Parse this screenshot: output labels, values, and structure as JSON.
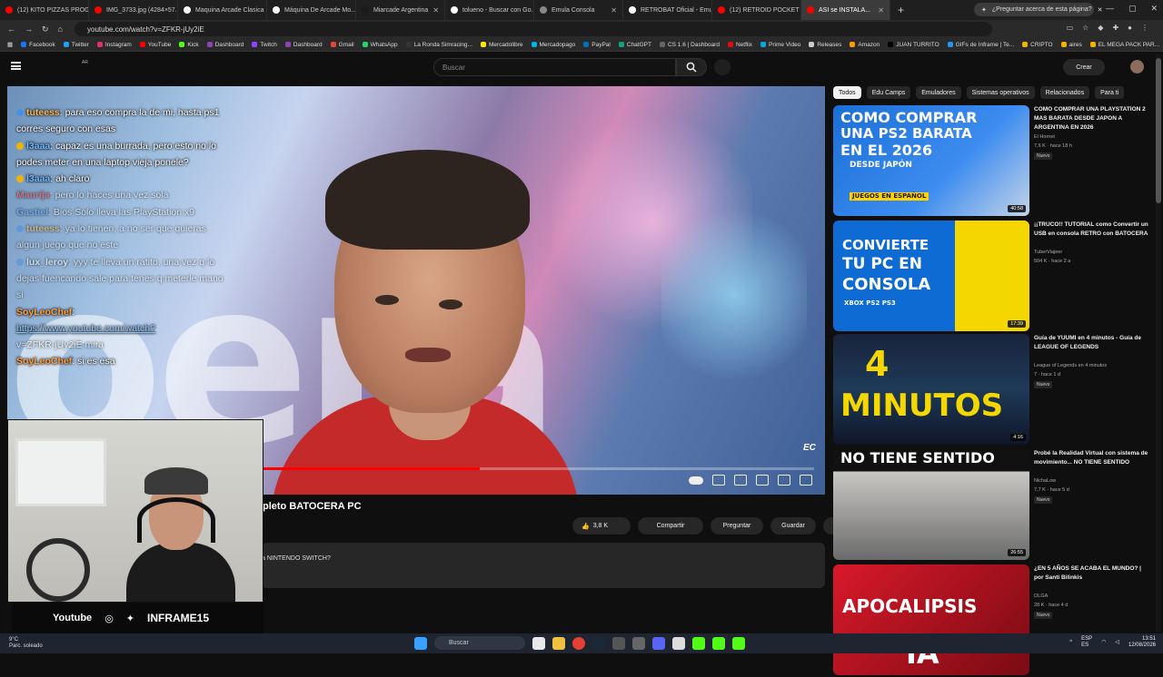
{
  "browser": {
    "tabs": [
      {
        "label": "(12) KITO PIZZAS PROGI...",
        "color": "#ff0000"
      },
      {
        "label": "IMG_3733.jpg (4284×57...",
        "color": "#ff0000"
      },
      {
        "label": "Maquina Arcade Clasica",
        "color": "#ffffff"
      },
      {
        "label": "Máquina De Arcade Mo...",
        "color": "#ffffff"
      },
      {
        "label": "Miarcade Argentina",
        "color": "#1a1a1a"
      },
      {
        "label": "tolueno - Buscar con Go...",
        "color": "#ffffff"
      },
      {
        "label": "Emula Consola",
        "color": "#888888"
      },
      {
        "label": "RETROBAT Oficial - Emu...",
        "color": "#ffffff"
      },
      {
        "label": "(12) RETROID POCKET 6...",
        "color": "#ff0000"
      },
      {
        "label": "ASI se INSTALA...",
        "color": "#ff0000",
        "active": true
      }
    ],
    "ask_tab": "¿Preguntar acerca de esta página?",
    "address": "youtube.com/watch?v=ZFKR-jUy2iE",
    "bookmarks": [
      {
        "label": "Facebook",
        "color": "#1877f2"
      },
      {
        "label": "Twitter",
        "color": "#1da1f2"
      },
      {
        "label": "Instagram",
        "color": "#e1306c"
      },
      {
        "label": "YouTube",
        "color": "#ff0000"
      },
      {
        "label": "Kick",
        "color": "#53fc18"
      },
      {
        "label": "Dashboard",
        "color": "#8e44ad"
      },
      {
        "label": "Twitch",
        "color": "#9146ff"
      },
      {
        "label": "Dashboard",
        "color": "#8e44ad"
      },
      {
        "label": "Gmail",
        "color": "#ea4335"
      },
      {
        "label": "WhatsApp",
        "color": "#25d366"
      },
      {
        "label": "La Ronda Simracing...",
        "color": "#333333"
      },
      {
        "label": "Mercadolibre",
        "color": "#ffe600"
      },
      {
        "label": "Mercadopago",
        "color": "#00b1ea"
      },
      {
        "label": "PayPal",
        "color": "#0070ba"
      },
      {
        "label": "ChatGPT",
        "color": "#10a37f"
      },
      {
        "label": "CS 1.6 | Dashboard",
        "color": "#666666"
      },
      {
        "label": "Netflix",
        "color": "#e50914"
      },
      {
        "label": "Prime Video",
        "color": "#00a8e1"
      },
      {
        "label": "Releases",
        "color": "#cccccc"
      },
      {
        "label": "Amazon",
        "color": "#ff9900"
      },
      {
        "label": "JUAN TURRITO",
        "color": "#000000"
      },
      {
        "label": "GIFs de Inframe | Te...",
        "color": "#2196f3"
      },
      {
        "label": "CRIPTO",
        "color": "#f0b400"
      },
      {
        "label": "aires",
        "color": "#f0b400"
      },
      {
        "label": "EL MEGA PACK PAR...",
        "color": "#f0b400"
      }
    ]
  },
  "youtube": {
    "country": "AR",
    "search_placeholder": "Buscar",
    "create_label": "Crear",
    "video_title": "pleto BATOCERA PC",
    "video_watermark": "EC",
    "progress": 0.58,
    "actions": {
      "likes": "3,8 K",
      "share": "Compartir",
      "ask": "Preguntar",
      "save": "Guardar"
    },
    "description_preview": "a NINTENDO SWITCH?"
  },
  "chat": [
    {
      "user": "tuteess",
      "color": "#ffb84d",
      "badge": "blue",
      "text": ": para eso compra la de mi, hasta ps1 corres seguro con esas",
      "faded": false
    },
    {
      "user": "l3aaa",
      "color": "#6fb8ff",
      "badge": "gold",
      "text": ": capaz es una burrada, pero esto no lo podes meter en una laptop vieja ponele?",
      "faded": false
    },
    {
      "user": "l3aaa",
      "color": "#6fb8ff",
      "badge": "gold",
      "text": ": ah claro",
      "faded": false
    },
    {
      "user": "Maurija",
      "color": "#ff4d4d",
      "badge": "",
      "text": ": pero lo haces una vez sola",
      "faded": true
    },
    {
      "user": "Gastiel",
      "color": "#5ba7ff",
      "badge": "",
      "text": ": Bios Solo lleva las PlayStation x9",
      "faded": true
    },
    {
      "user": "tuteess",
      "color": "#ffb84d",
      "badge": "blue",
      "text": ": ya lo tienen, a no ser que quieras algun juego que no este",
      "faded": true
    },
    {
      "user": "lux_leroy",
      "color": "#ffffff",
      "badge": "blue",
      "text": ": yyy te lleva un ratito, una vez q lo dejas fuencando sale para tenes q meterle mano si",
      "faded": true
    },
    {
      "user": "SoyLeoChef",
      "color": "#ff9e3d",
      "badge": "",
      "text": ":",
      "faded": false
    },
    {
      "user": "",
      "color": "#ffffff",
      "badge": "",
      "text": "",
      "link": "https://www.youtube.com/watch?",
      "linkTail": "v=ZFKR-jUy2iE mira",
      "faded": false
    },
    {
      "user": "SoyLeoChef",
      "color": "#ff9e3d",
      "badge": "",
      "text": ": si es esa",
      "faded": false
    }
  ],
  "webcam": {
    "socials": {
      "youtube": "Youtube",
      "handle": "INFRAME15"
    }
  },
  "sidebar": {
    "chips": [
      {
        "label": "Todos",
        "active": true
      },
      {
        "label": "Edu Camps",
        "active": false
      },
      {
        "label": "Emuladores",
        "active": false
      },
      {
        "label": "Sistemas operativos",
        "active": false
      },
      {
        "label": "Relacionados",
        "active": false
      },
      {
        "label": "Para ti",
        "active": false
      }
    ],
    "videos": [
      {
        "title": "COMO COMPRAR UNA PLAYSTATION 2 MAS BARATA DESDE JAPON A ARGENTINA EN 2026",
        "channel": "El Hornet",
        "meta": "7,6 K · hace 18 h",
        "badge": "Nuevo",
        "duration": "40:58",
        "thumb_text": [
          "COMO COMPRAR",
          "UNA PS2 BARATA",
          "EN EL 2026",
          "DESDE JAPÓN",
          "JUEGOS EN ESPAÑOL"
        ]
      },
      {
        "title": "¡¡TRUCO!! TUTORIAL como Convertir un USB en consola RETRO con BATOCERA",
        "channel": "TuberViajeer",
        "meta": "504 K · hace 2 a",
        "badge": "",
        "duration": "17:39",
        "thumb_text": [
          "CONVIERTE",
          "TU PC EN",
          "CONSOLA",
          "XBOX PS2 PS3"
        ]
      },
      {
        "title": "Guía de YUUMI en 4 minutos - Guía de LEAGUE OF LEGENDS",
        "channel": "League of Legends en 4 minutos",
        "meta": "7 · hace 1 d",
        "badge": "Nuevo",
        "duration": "4:16",
        "thumb_text": [
          "4",
          "MINUTOS"
        ]
      },
      {
        "title": "Probé la Realidad Virtual con sistema de movimiento... NO TIENE SENTIDO",
        "channel": "NichaLow",
        "meta": "7,7 K · hace 5 d",
        "badge": "Nuevo",
        "duration": "26:55",
        "thumb_text": [
          "NO TIENE SENTIDO"
        ]
      },
      {
        "title": "¿EN 5 AÑOS SE ACABA EL MUNDO? | por Santi Bilinkis",
        "channel": "OLGA",
        "meta": "28 K · hace 4 d",
        "badge": "Nuevo",
        "duration": "",
        "thumb_text": [
          "APOCALIPSIS",
          "IA"
        ]
      }
    ]
  },
  "taskbar": {
    "weather_temp": "9°C",
    "weather_desc": "Parc. soleado",
    "search_label": "Buscar",
    "lang": "ESP",
    "lang2": "ES",
    "time": "13:51",
    "date": "12/08/2026"
  }
}
